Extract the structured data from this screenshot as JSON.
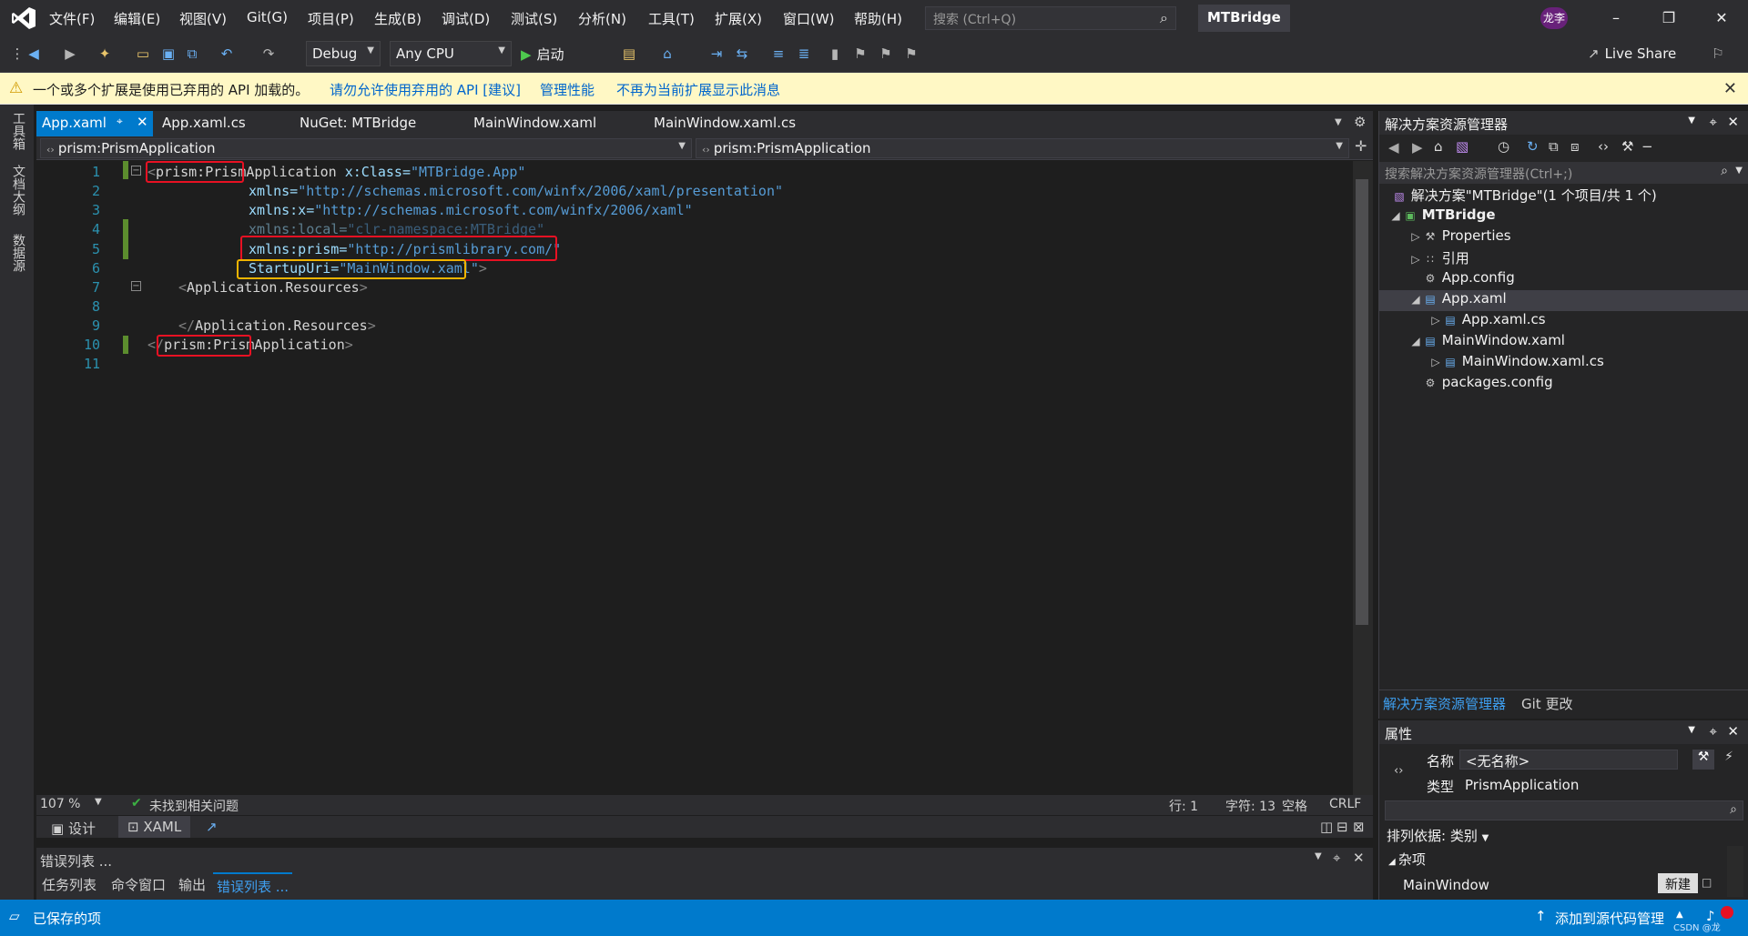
{
  "menubar": {
    "items": [
      "文件(F)",
      "编辑(E)",
      "视图(V)",
      "Git(G)",
      "项目(P)",
      "生成(B)",
      "调试(D)",
      "测试(S)",
      "分析(N)",
      "工具(T)",
      "扩展(X)",
      "窗口(W)",
      "帮助(H)"
    ],
    "search_placeholder": "搜索 (Ctrl+Q)",
    "solution_title": "MTBridge",
    "user_initials": "龙李"
  },
  "toolbar": {
    "configuration": "Debug",
    "platform": "Any CPU",
    "start_label": "启动",
    "live_share": "Live Share"
  },
  "infobar": {
    "message": "一个或多个扩展是使用已弃用的 API 加载的。",
    "link_allow": "请勿允许使用弃用的 API [建议]",
    "link_manage": "管理性能",
    "link_dismiss": "不再为当前扩展显示此消息"
  },
  "left_tabs": [
    "工具箱",
    "文档大纲",
    "数据源"
  ],
  "doc_tabs": [
    "App.xaml",
    "App.xaml.cs",
    "NuGet: MTBridge",
    "MainWindow.xaml",
    "MainWindow.xaml.cs"
  ],
  "nav": {
    "left": "prism:PrismApplication",
    "right": "prism:PrismApplication"
  },
  "code": {
    "line_numbers": [
      "1",
      "2",
      "3",
      "4",
      "5",
      "6",
      "7",
      "8",
      "9",
      "10",
      "11"
    ],
    "l1_lt": "<",
    "l1_tag": "prism:PrismApplication",
    "l1_attr": " x:Class=",
    "l1_val": "\"MTBridge.App\"",
    "l2_attr": "xmlns=",
    "l2_val": "\"http://schemas.microsoft.com/winfx/2006/xaml/presentation\"",
    "l3_attr": "xmlns:x=",
    "l3_val": "\"http://schemas.microsoft.com/winfx/2006/xaml\"",
    "l4_attr": "xmlns:local=",
    "l4_val": "\"clr-namespace:MTBridge\"",
    "l5_attr": "xmlns:prism=",
    "l5_val": "\"http://prismlibrary.com/\"",
    "l6_attr": "StartupUri=",
    "l6_val": "\"MainWindow.xaml\"",
    "l6_gt": ">",
    "l7_lt": "<",
    "l7_tag": "Application.Resources",
    "l7_gt": ">",
    "l9_lt": "</",
    "l9_tag": "Application.Resources",
    "l9_gt": ">",
    "l10_lt": "</",
    "l10_tag": "prism:PrismApplication",
    "l10_gt": ">"
  },
  "editor_status": {
    "zoom": "107 %",
    "issues": "未找到相关问题",
    "line": "行: 1",
    "char": "字符: 13",
    "spaces": "空格",
    "eol": "CRLF"
  },
  "view_tabs": {
    "design": "设计",
    "xaml": "XAML"
  },
  "error_panel": {
    "title": "错误列表 ...",
    "tabs": [
      "任务列表",
      "命令窗口",
      "输出",
      "错误列表 ..."
    ]
  },
  "solution_explorer": {
    "title": "解决方案资源管理器",
    "search_placeholder": "搜索解决方案资源管理器(Ctrl+;)",
    "tree": [
      {
        "label": "解决方案\"MTBridge\"(1 个项目/共 1 个)"
      },
      {
        "label": "MTBridge"
      },
      {
        "label": "Properties"
      },
      {
        "label": "引用"
      },
      {
        "label": "App.config"
      },
      {
        "label": "App.xaml"
      },
      {
        "label": "App.xaml.cs"
      },
      {
        "label": "MainWindow.xaml"
      },
      {
        "label": "MainWindow.xaml.cs"
      },
      {
        "label": "packages.config"
      }
    ],
    "bottom_tabs": [
      "解决方案资源管理器",
      "Git 更改"
    ]
  },
  "properties": {
    "title": "属性",
    "name_label": "名称",
    "name_value": "<无名称>",
    "type_label": "类型",
    "type_value": "PrismApplication",
    "sort_label": "排列依据: 类别",
    "category": "杂项",
    "row_label": "MainWindow",
    "new_button": "新建"
  },
  "statusbar": {
    "saved": "已保存的项",
    "source_control": "添加到源代码管理",
    "watermark": "CSDN @龙"
  }
}
